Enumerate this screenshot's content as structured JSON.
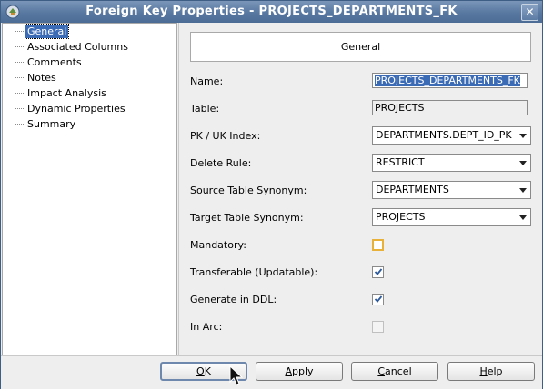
{
  "window": {
    "title": "Foreign Key Properties - PROJECTS_DEPARTMENTS_FK",
    "close_glyph": "✕"
  },
  "nav": {
    "items": [
      {
        "label": "General",
        "selected": true
      },
      {
        "label": "Associated Columns",
        "selected": false
      },
      {
        "label": "Comments",
        "selected": false
      },
      {
        "label": "Notes",
        "selected": false
      },
      {
        "label": "Impact Analysis",
        "selected": false
      },
      {
        "label": "Dynamic Properties",
        "selected": false
      },
      {
        "label": "Summary",
        "selected": false
      }
    ]
  },
  "panel": {
    "header": "General",
    "name": {
      "label": "Name:",
      "value": "PROJECTS_DEPARTMENTS_FK"
    },
    "table": {
      "label": "Table:",
      "value": "PROJECTS"
    },
    "pk_uk_index": {
      "label": "PK / UK Index:",
      "value": "DEPARTMENTS.DEPT_ID_PK"
    },
    "delete_rule": {
      "label": "Delete Rule:",
      "value": "RESTRICT"
    },
    "source_table_synonym": {
      "label": "Source Table Synonym:",
      "value": "DEPARTMENTS"
    },
    "target_table_synonym": {
      "label": "Target Table Synonym:",
      "value": "PROJECTS"
    },
    "mandatory": {
      "label": "Mandatory:",
      "checked": false
    },
    "transferable": {
      "label": "Transferable (Updatable):",
      "checked": true
    },
    "generate_in_ddl": {
      "label": "Generate in DDL:",
      "checked": true
    },
    "in_arc": {
      "label": "In Arc:",
      "checked": false
    }
  },
  "buttons": {
    "ok": {
      "mnemonic": "O",
      "rest": "K"
    },
    "apply": {
      "mnemonic": "A",
      "rest": "pply"
    },
    "cancel": {
      "mnemonic": "C",
      "rest": "ancel"
    },
    "help": {
      "mnemonic": "H",
      "rest": "elp"
    }
  },
  "colors": {
    "title_bar": "#5878a1",
    "selection": "#3c6bb5",
    "focus_ring": "#e8b13a"
  },
  "icons": {
    "app": "app-icon",
    "close": "close-icon",
    "dropdown": "chevron-down-icon",
    "check": "checkmark-icon",
    "cursor": "mouse-pointer-icon"
  }
}
